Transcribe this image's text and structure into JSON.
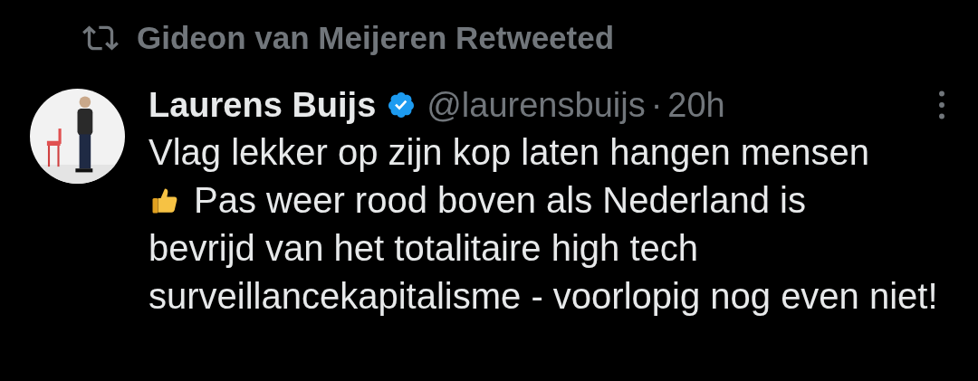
{
  "retweet": {
    "text": "Gideon van Meijeren Retweeted"
  },
  "tweet": {
    "name": "Laurens Buijs",
    "verified": true,
    "handle": "@laurensbuijs",
    "separator": "·",
    "time": "20h",
    "body": [
      "Vlag lekker op zijn kop laten hangen mensen",
      "Pas weer rood boven als Nederland is",
      "bevrijd van het totalitaire high tech surveillancekapitalisme - voorlopig nog even niet!"
    ]
  }
}
